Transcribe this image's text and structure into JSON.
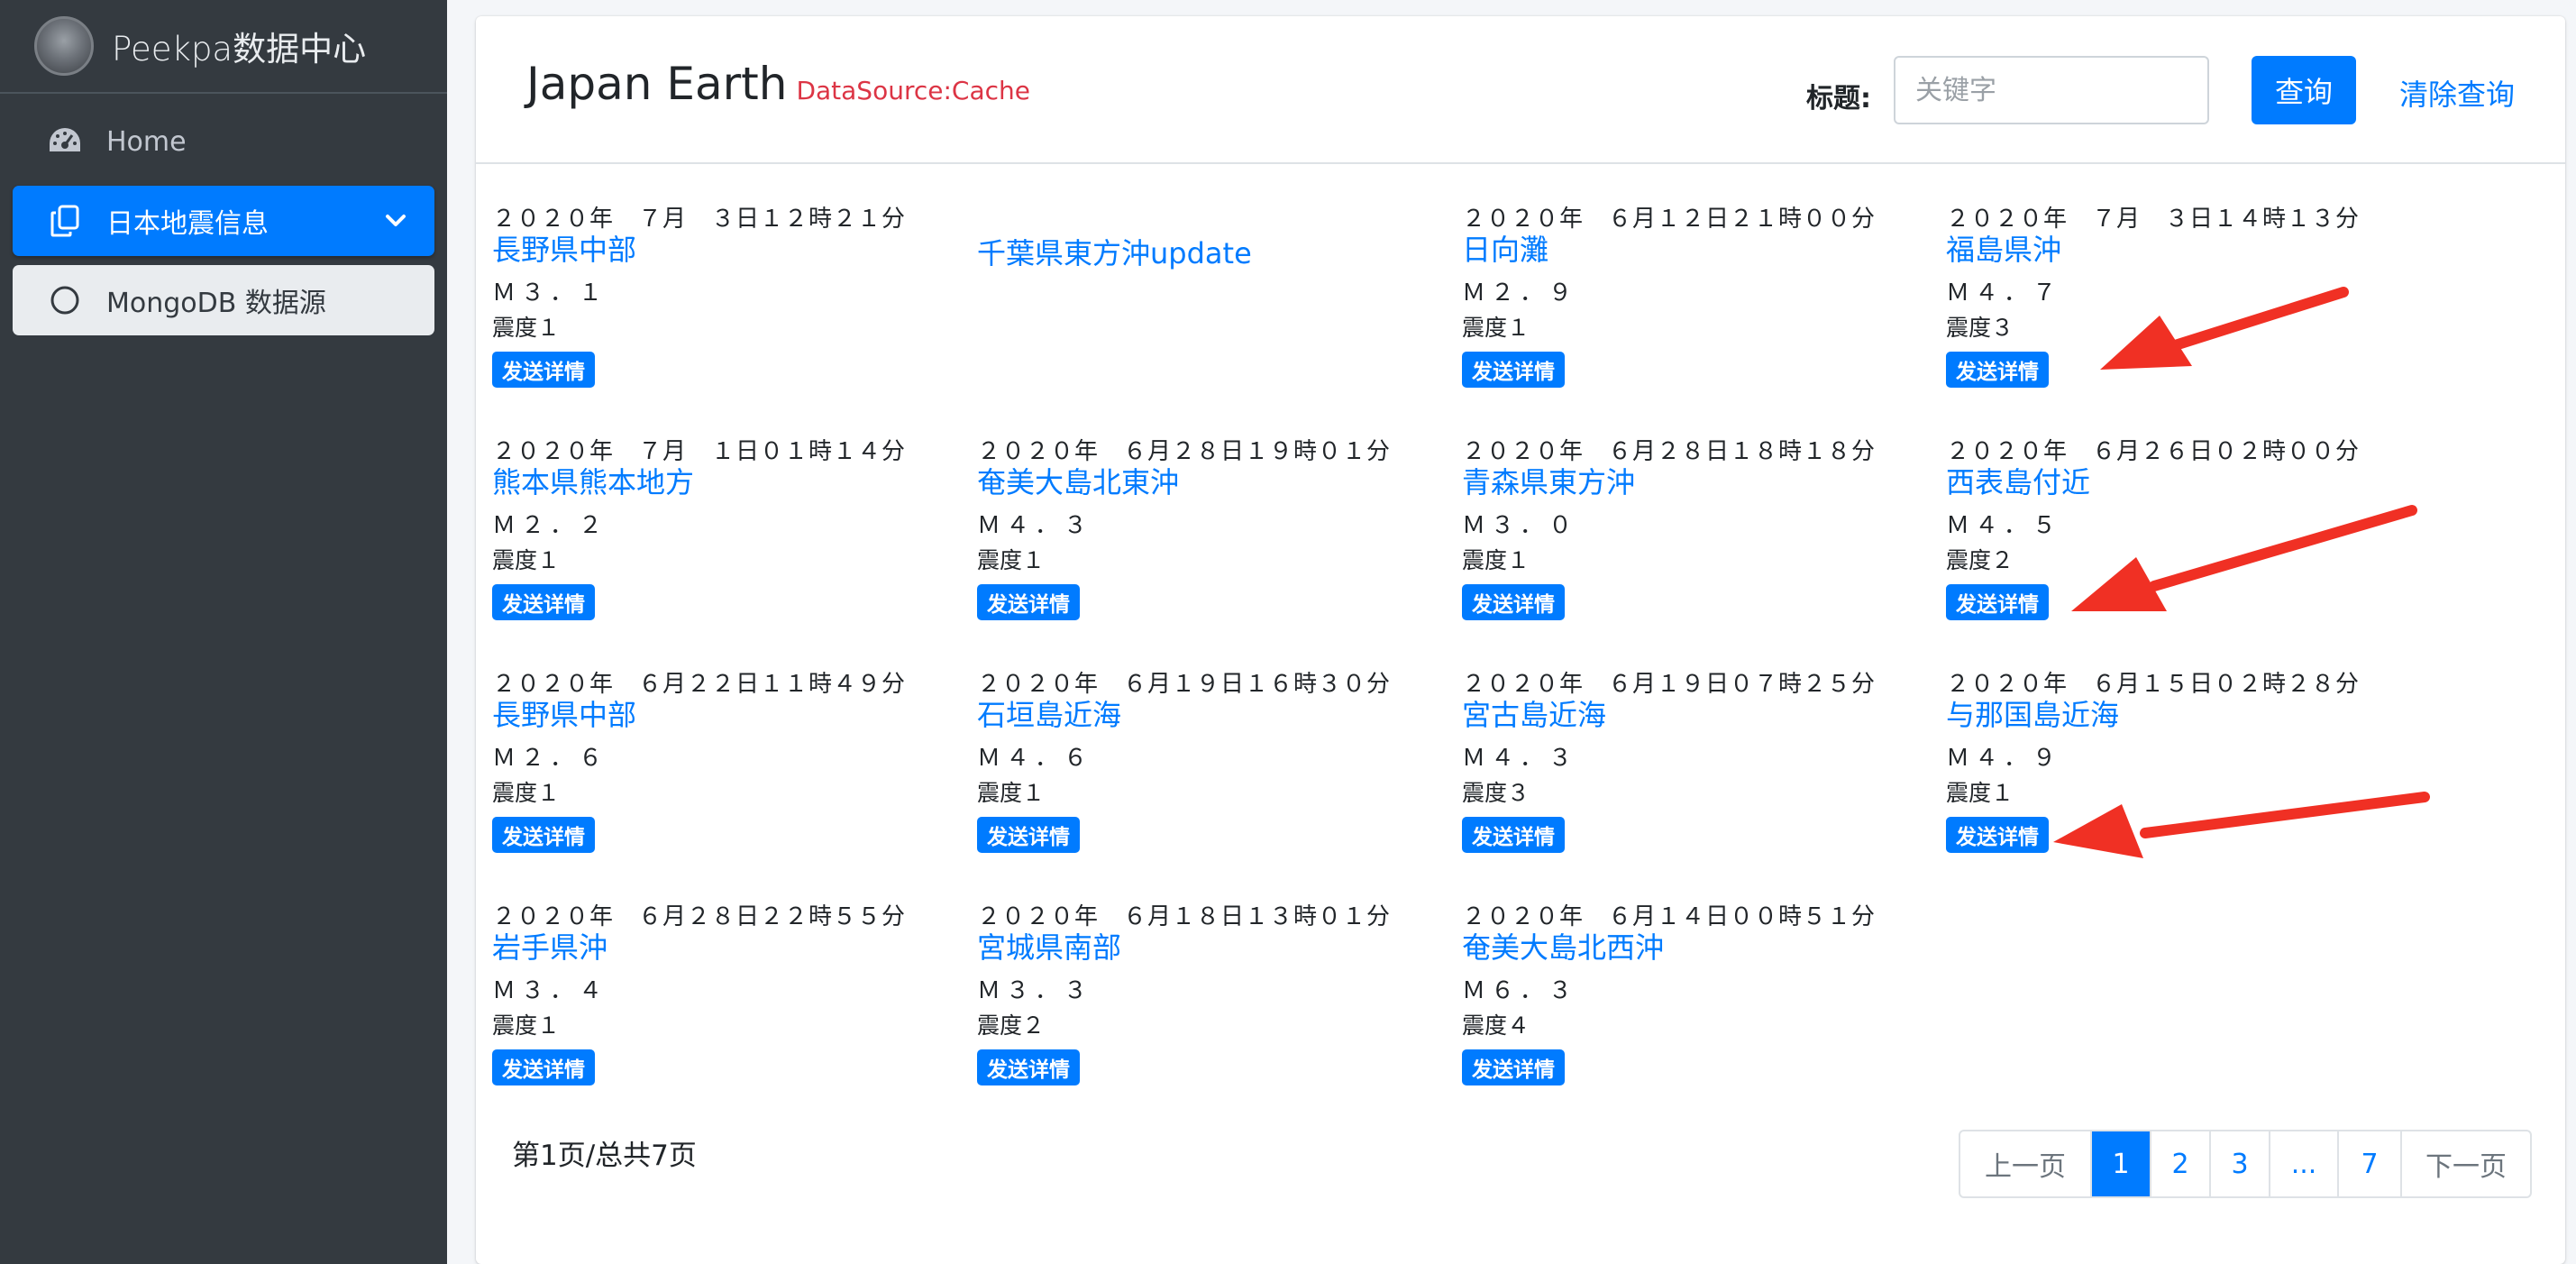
{
  "sidebar": {
    "brand": "Peekpa数据中心",
    "items": [
      {
        "label": "Home",
        "icon": "dashboard-icon"
      },
      {
        "label": "日本地震信息",
        "icon": "copy-icon"
      },
      {
        "label": "MongoDB 数据源",
        "icon": "circle-icon"
      }
    ]
  },
  "header": {
    "title": "Japan Earth",
    "source": "DataSource:Cache",
    "search_label": "标题:",
    "search_placeholder": "关键字",
    "query_button": "查询",
    "clear_button": "清除查询"
  },
  "quakes": [
    {
      "time": "２０２０年　７月　３日１２時２１分",
      "place": "長野県中部",
      "mag": "Ｍ３．１",
      "intensity": "震度１",
      "button": "发送详情"
    },
    {
      "time": "",
      "place": "千葉県東方沖update",
      "mag": "",
      "intensity": "",
      "button": ""
    },
    {
      "time": "２０２０年　６月１２日２１時００分",
      "place": "日向灘",
      "mag": "Ｍ２．９",
      "intensity": "震度１",
      "button": "发送详情"
    },
    {
      "time": "２０２０年　７月　３日１４時１３分",
      "place": "福島県沖",
      "mag": "Ｍ４．７",
      "intensity": "震度３",
      "button": "发送详情"
    },
    {
      "time": "２０２０年　７月　１日０１時１４分",
      "place": "熊本県熊本地方",
      "mag": "Ｍ２．２",
      "intensity": "震度１",
      "button": "发送详情"
    },
    {
      "time": "２０２０年　６月２８日１９時０１分",
      "place": "奄美大島北東沖",
      "mag": "Ｍ４．３",
      "intensity": "震度１",
      "button": "发送详情"
    },
    {
      "time": "２０２０年　６月２８日１８時１８分",
      "place": "青森県東方沖",
      "mag": "Ｍ３．０",
      "intensity": "震度１",
      "button": "发送详情"
    },
    {
      "time": "２０２０年　６月２６日０２時００分",
      "place": "西表島付近",
      "mag": "Ｍ４．５",
      "intensity": "震度２",
      "button": "发送详情"
    },
    {
      "time": "２０２０年　６月２２日１１時４９分",
      "place": "長野県中部",
      "mag": "Ｍ２．６",
      "intensity": "震度１",
      "button": "发送详情"
    },
    {
      "time": "２０２０年　６月１９日１６時３０分",
      "place": "石垣島近海",
      "mag": "Ｍ４．６",
      "intensity": "震度１",
      "button": "发送详情"
    },
    {
      "time": "２０２０年　６月１９日０７時２５分",
      "place": "宮古島近海",
      "mag": "Ｍ４．３",
      "intensity": "震度３",
      "button": "发送详情"
    },
    {
      "time": "２０２０年　６月１５日０２時２８分",
      "place": "与那国島近海",
      "mag": "Ｍ４．９",
      "intensity": "震度１",
      "button": "发送详情"
    },
    {
      "time": "２０２０年　６月２８日２２時５５分",
      "place": "岩手県沖",
      "mag": "Ｍ３．４",
      "intensity": "震度１",
      "button": "发送详情"
    },
    {
      "time": "２０２０年　６月１８日１３時０１分",
      "place": "宮城県南部",
      "mag": "Ｍ３．３",
      "intensity": "震度２",
      "button": "发送详情"
    },
    {
      "time": "２０２０年　６月１４日００時５１分",
      "place": "奄美大島北西沖",
      "mag": "Ｍ６．３",
      "intensity": "震度４",
      "button": "发送详情"
    }
  ],
  "footer": {
    "page_info": "第1页/总共7页",
    "pages": [
      {
        "label": "上一页",
        "state": "disabled"
      },
      {
        "label": "1",
        "state": "active"
      },
      {
        "label": "2",
        "state": "normal"
      },
      {
        "label": "3",
        "state": "normal"
      },
      {
        "label": "...",
        "state": "normal"
      },
      {
        "label": "7",
        "state": "normal"
      },
      {
        "label": "下一页",
        "state": "disabled"
      }
    ]
  },
  "annotation_color": "#f03024",
  "accent_color": "#007bff"
}
